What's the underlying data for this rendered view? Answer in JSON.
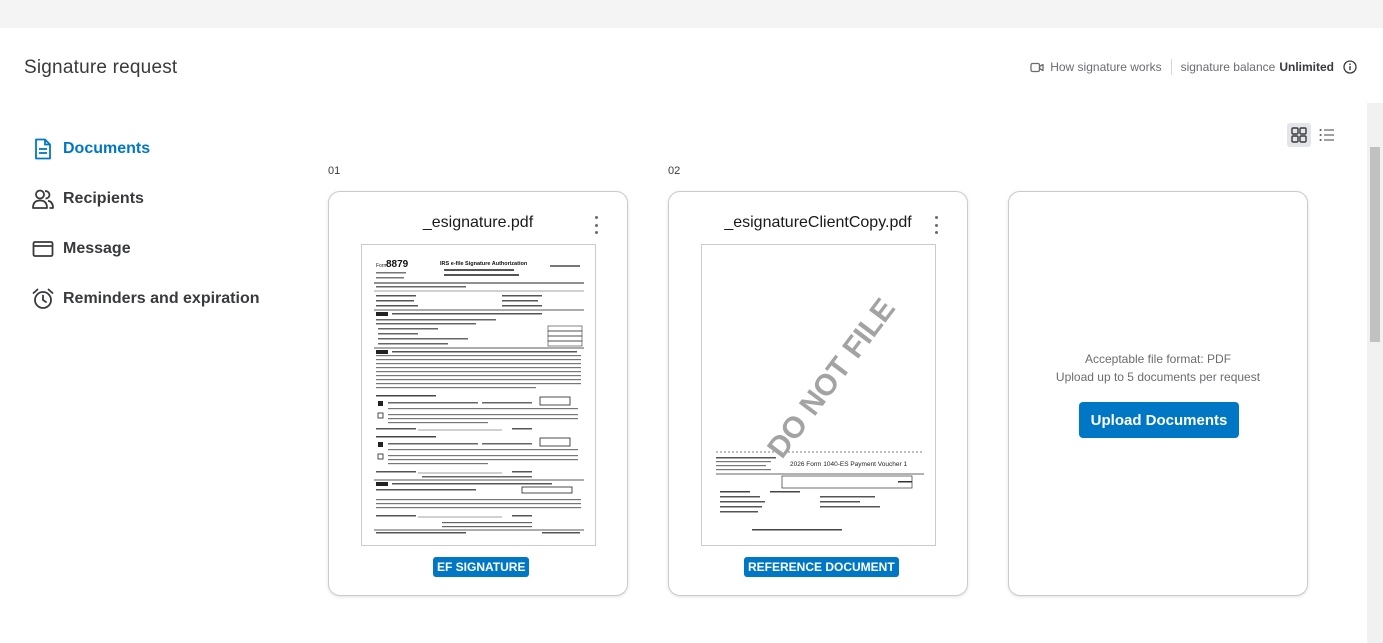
{
  "header": {
    "title": "Signature request",
    "how_link": "How signature works",
    "balance_label": "signature balance",
    "balance_value": "Unlimited"
  },
  "sidebar": {
    "items": [
      {
        "label": "Documents",
        "icon": "document-icon",
        "active": true
      },
      {
        "label": "Recipients",
        "icon": "people-icon",
        "active": false
      },
      {
        "label": "Message",
        "icon": "envelope-icon",
        "active": false
      },
      {
        "label": "Reminders and expiration",
        "icon": "alarm-clock-icon",
        "active": false
      }
    ]
  },
  "documents": [
    {
      "index": "01",
      "filename": "_esignature.pdf",
      "tag": "EF SIGNATURE",
      "preview": {
        "form_number": "8879",
        "form_title": "IRS e-file Signature Authorization"
      }
    },
    {
      "index": "02",
      "filename": "_esignatureClientCopy.pdf",
      "tag": "REFERENCE DOCUMENT",
      "preview": {
        "watermark": "DO NOT FILE",
        "voucher_title": "2026 Form 1040-ES Payment Voucher 1"
      }
    }
  ],
  "upload": {
    "format_text": "Acceptable file format: PDF",
    "limit_text": "Upload up to 5 documents per request",
    "button_label": "Upload Documents"
  },
  "colors": {
    "accent": "#0077c5",
    "text": "#393a3d",
    "muted": "#6b6c72"
  }
}
